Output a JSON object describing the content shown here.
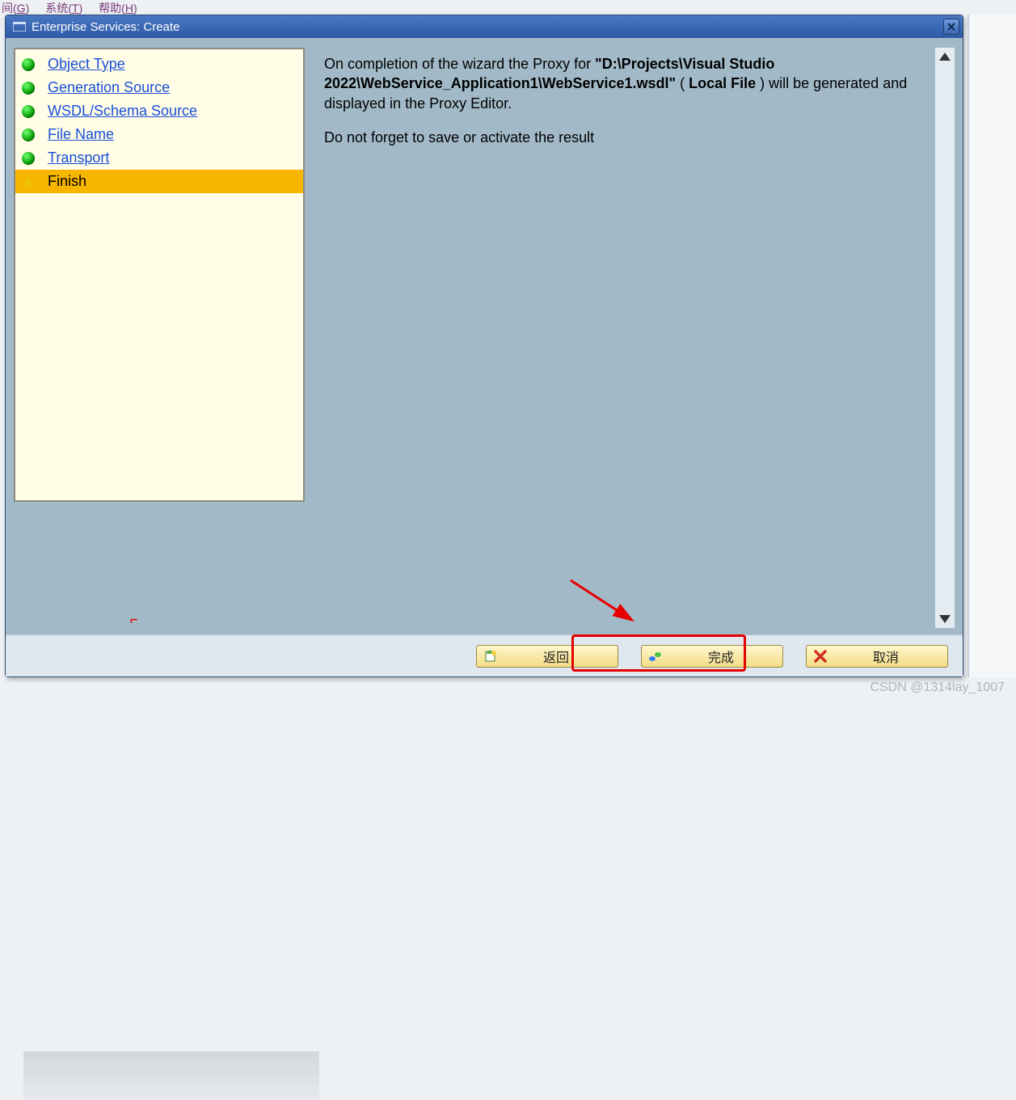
{
  "bg_menu": {
    "item1_prefix": "间(",
    "item1_key": "G",
    "item1_suffix": ")",
    "item2_prefix": "系统(",
    "item2_key": "T",
    "item2_suffix": ")",
    "item3_prefix": "帮助(",
    "item3_key": "H",
    "item3_suffix": ")"
  },
  "dialog": {
    "title": "Enterprise Services: Create"
  },
  "steps": [
    {
      "icon": "green",
      "label": "Object Type",
      "link": true
    },
    {
      "icon": "green",
      "label": "Generation Source",
      "link": true
    },
    {
      "icon": "green",
      "label": "WSDL/Schema Source",
      "link": true
    },
    {
      "icon": "green",
      "label": "File Name",
      "link": true
    },
    {
      "icon": "green",
      "label": "Transport",
      "link": true
    },
    {
      "icon": "warn",
      "label": "Finish",
      "link": false,
      "current": true
    }
  ],
  "content": {
    "p1_pre": "On completion of the wizard the Proxy for ",
    "p1_path": "\"D:\\Projects\\Visual Studio 2022\\WebService_Application1\\WebService1.wsdl\"",
    "p1_mid1": " ( ",
    "p1_local": "Local File",
    "p1_mid2": " ) will be generated and displayed in the Proxy Editor.",
    "p2": "Do not forget to save or activate the result"
  },
  "buttons": {
    "back": "返回",
    "finish": "完成",
    "cancel": "取消"
  },
  "watermark": "CSDN @1314lay_1007"
}
